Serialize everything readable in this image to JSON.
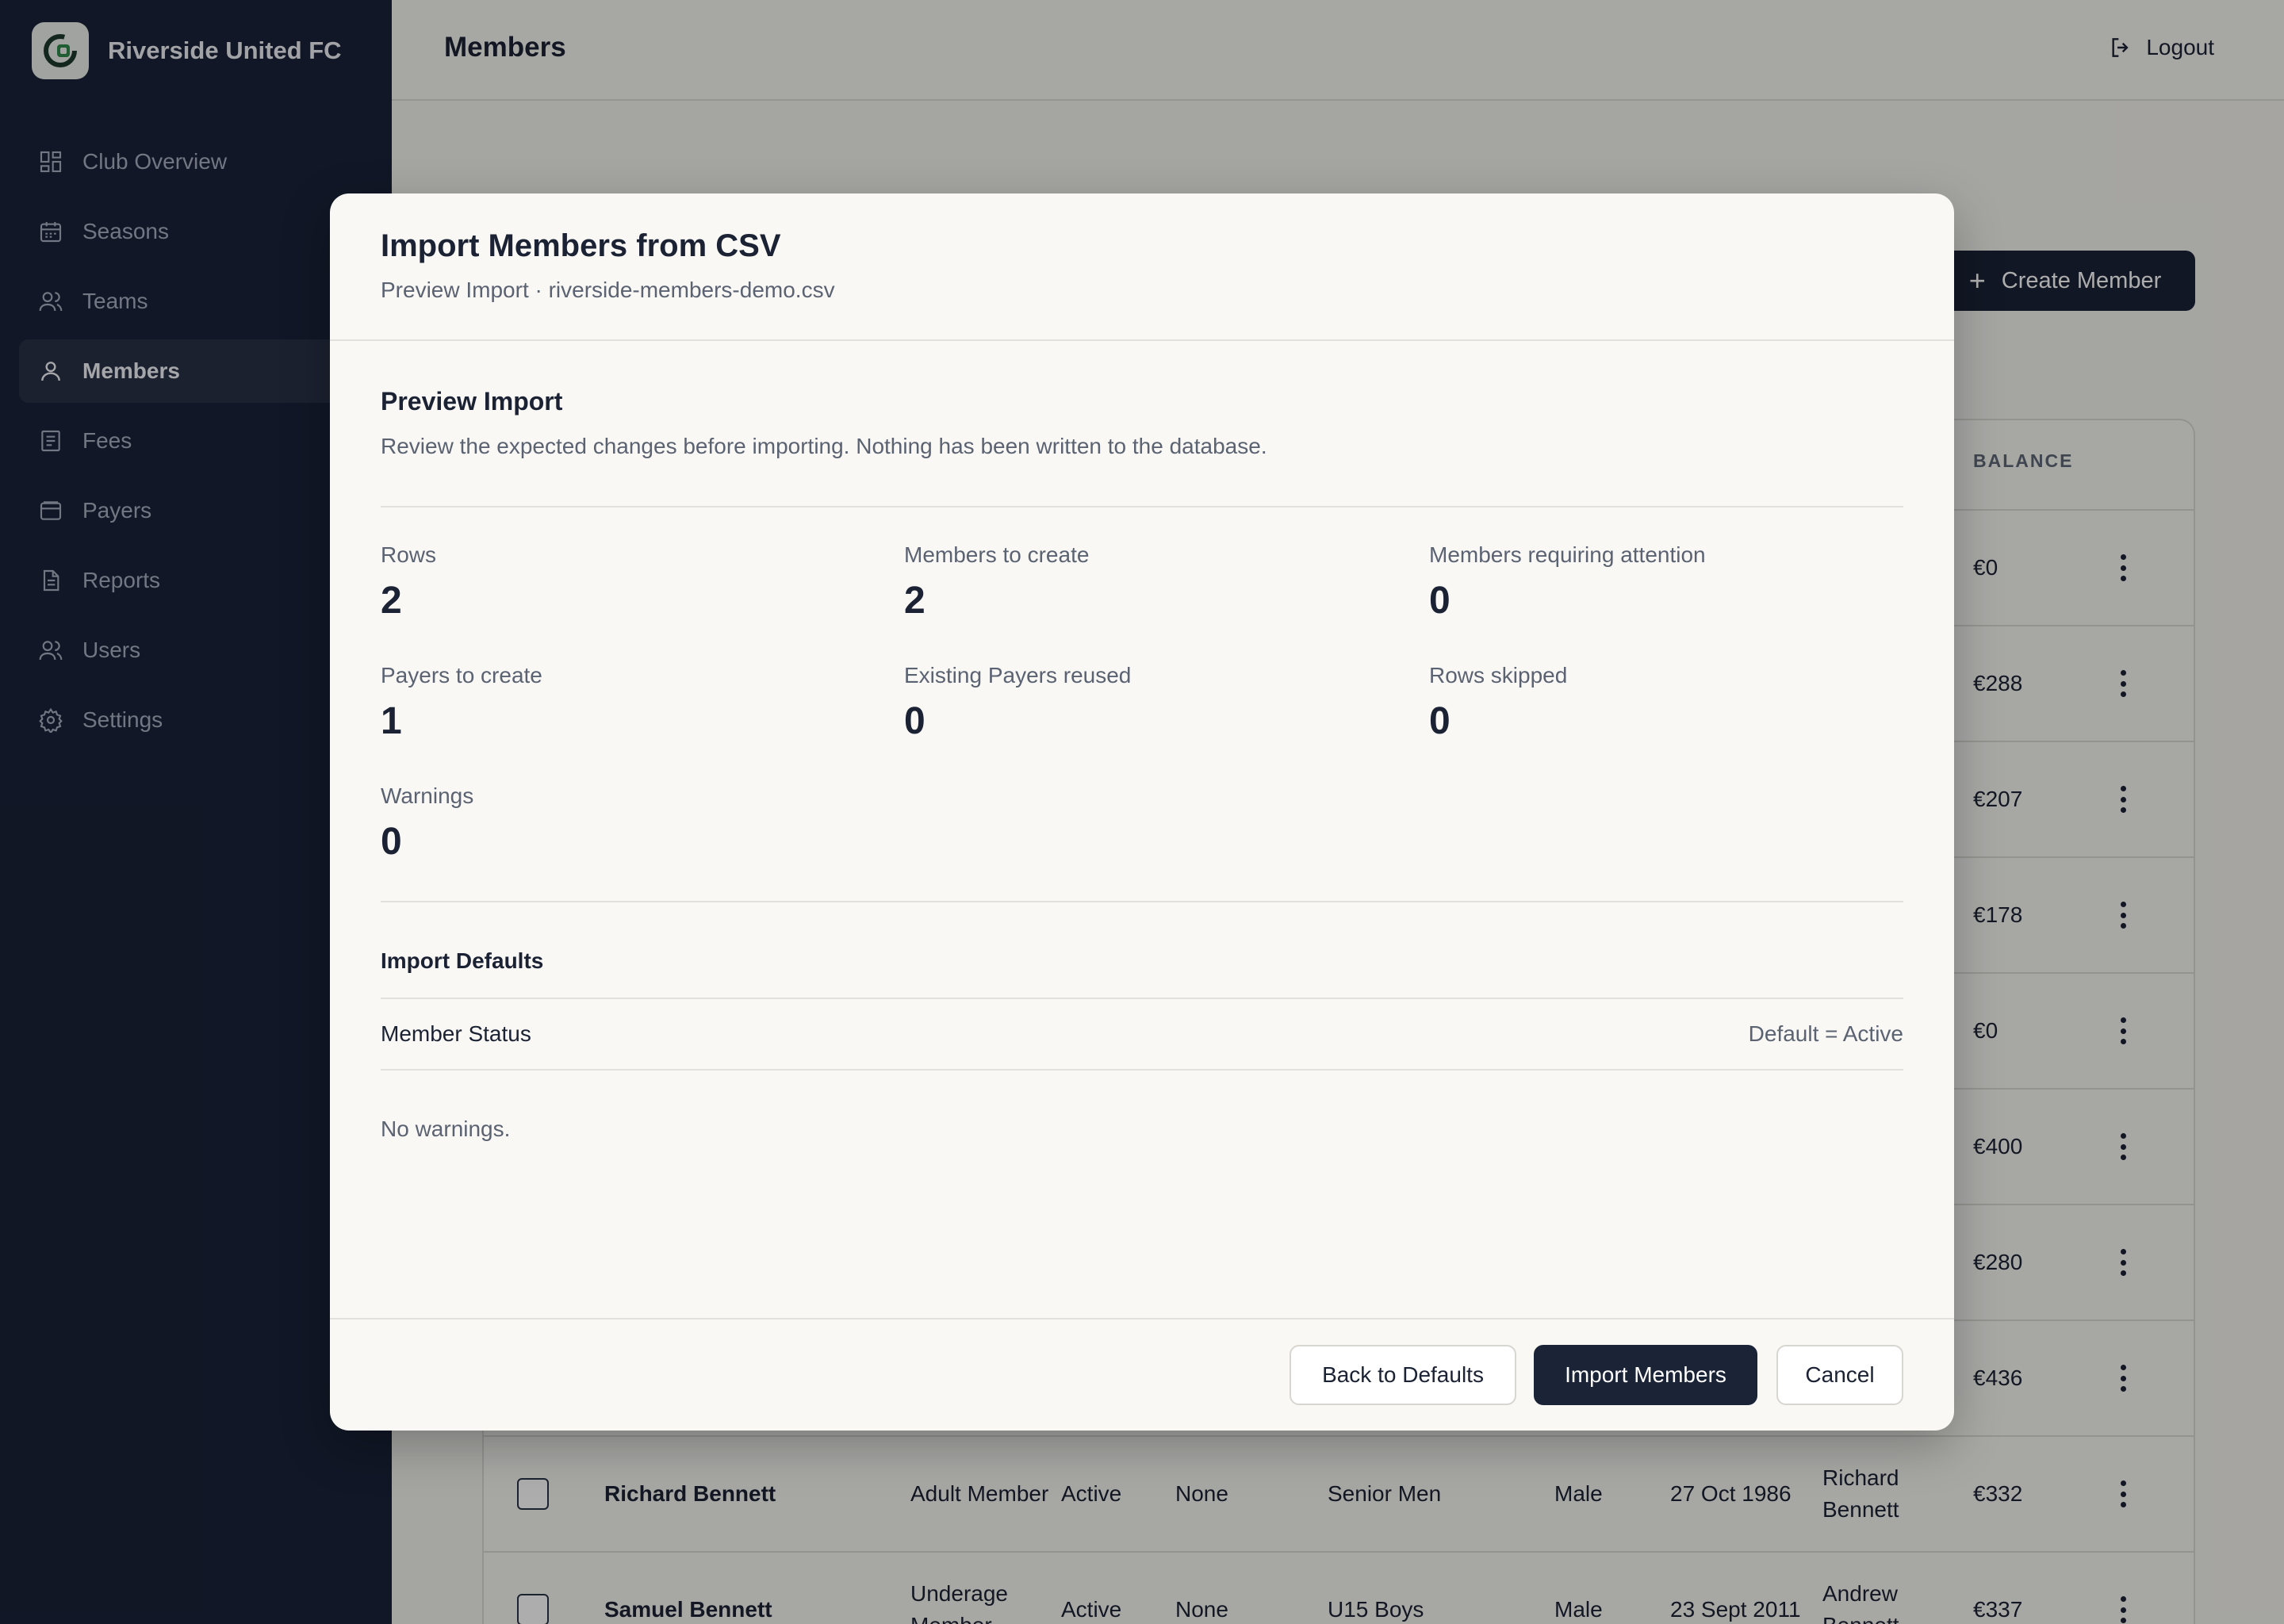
{
  "app": {
    "club_name": "Riverside United FC",
    "logo_icon": "club-logo-icon"
  },
  "sidebar": {
    "items": [
      {
        "label": "Club Overview",
        "icon": "grid-icon",
        "active": false
      },
      {
        "label": "Seasons",
        "icon": "calendar-icon",
        "active": false
      },
      {
        "label": "Teams",
        "icon": "users-icon",
        "active": false
      },
      {
        "label": "Members",
        "icon": "user-icon",
        "active": true
      },
      {
        "label": "Fees",
        "icon": "receipt-icon",
        "active": false
      },
      {
        "label": "Payers",
        "icon": "wallet-icon",
        "active": false
      },
      {
        "label": "Reports",
        "icon": "document-icon",
        "active": false
      },
      {
        "label": "Users",
        "icon": "users-icon",
        "active": false
      },
      {
        "label": "Settings",
        "icon": "gear-icon",
        "active": false
      }
    ]
  },
  "header": {
    "title": "Members",
    "logout_label": "Logout"
  },
  "toolbar": {
    "create_member_label": "Create Member"
  },
  "table": {
    "balance_header": "BALANCE",
    "visible_balances": [
      "€0",
      "€288",
      "€207",
      "€178",
      "€0",
      "€400",
      "€280",
      "€436"
    ],
    "rows": [
      {
        "name": "Richard Bennett",
        "type": "Adult Member",
        "status": "Active",
        "discount": "None",
        "team": "Senior Men",
        "gender": "Male",
        "dob": "27 Oct 1986",
        "payer": "Richard Bennett",
        "balance": "€332"
      },
      {
        "name": "Samuel Bennett",
        "type": "Underage Member",
        "status": "Active",
        "discount": "None",
        "team": "U15 Boys",
        "gender": "Male",
        "dob": "23 Sept 2011",
        "payer": "Andrew Bennett",
        "balance": "€337"
      }
    ]
  },
  "modal": {
    "title": "Import Members from CSV",
    "subtitle": "Preview Import · riverside-members-demo.csv",
    "section_title": "Preview Import",
    "section_desc": "Review the expected changes before importing. Nothing has been written to the database.",
    "stats": [
      {
        "label": "Rows",
        "value": "2"
      },
      {
        "label": "Members to create",
        "value": "2"
      },
      {
        "label": "Members requiring attention",
        "value": "0"
      },
      {
        "label": "Payers to create",
        "value": "1"
      },
      {
        "label": "Existing Payers reused",
        "value": "0"
      },
      {
        "label": "Rows skipped",
        "value": "0"
      },
      {
        "label": "Warnings",
        "value": "0"
      }
    ],
    "defaults_title": "Import Defaults",
    "default_row": {
      "label": "Member Status",
      "value": "Default = Active"
    },
    "no_warnings": "No warnings.",
    "buttons": {
      "back": "Back to Defaults",
      "import": "Import Members",
      "cancel": "Cancel"
    }
  }
}
